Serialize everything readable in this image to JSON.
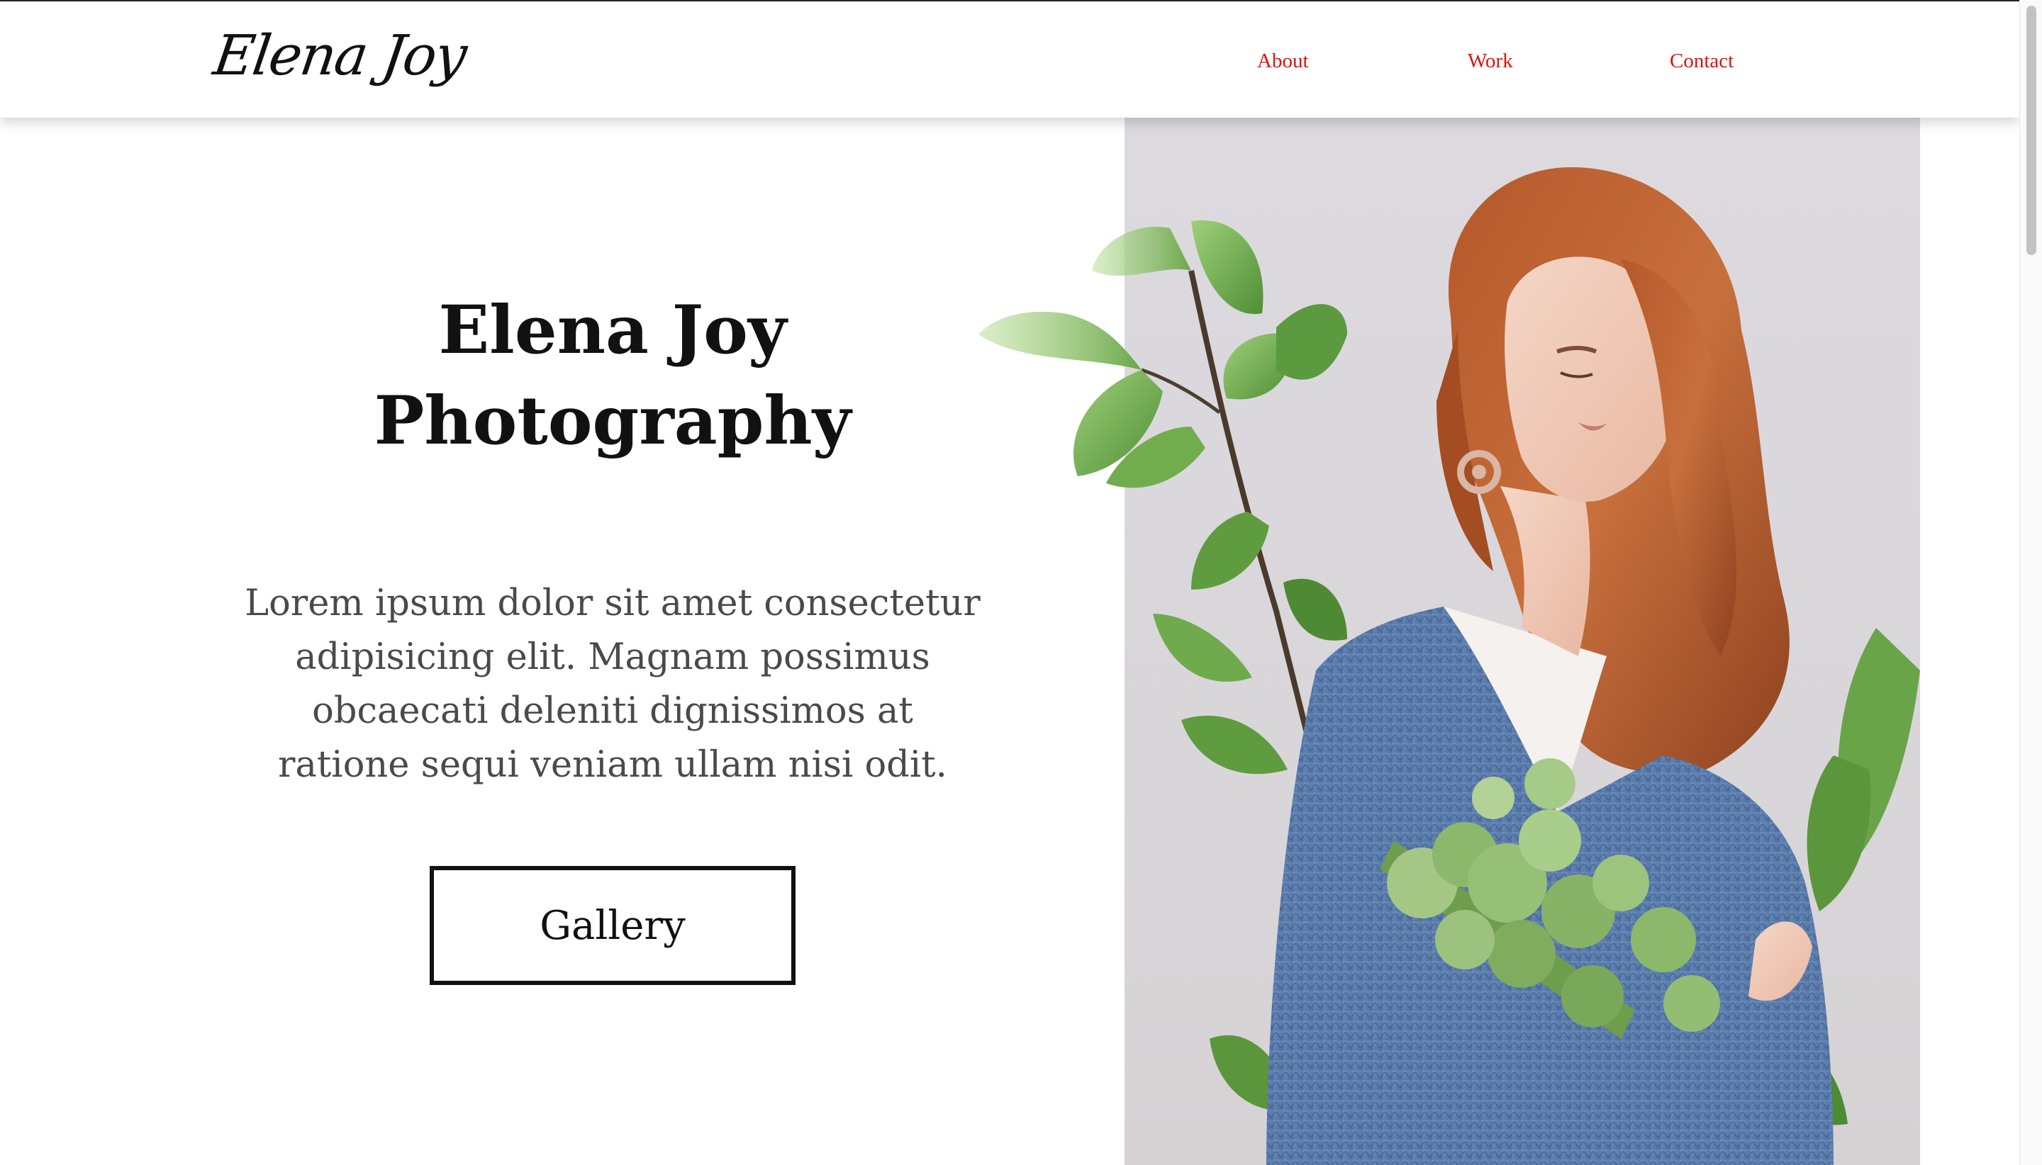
{
  "header": {
    "logo_text": "Elena Joy",
    "nav": [
      {
        "label": "About"
      },
      {
        "label": "Work"
      },
      {
        "label": "Contact"
      }
    ]
  },
  "hero": {
    "title_line1": "Elena Joy",
    "title_line2": "Photography",
    "body": "Lorem ipsum dolor sit amet consectetur adipisicing elit. Magnam possimus obcaecati deleniti dignissimos at ratione sequi veniam ullam nisi odit.",
    "button_label": "Gallery"
  },
  "colors": {
    "nav_link": "#e01010",
    "title": "#111111",
    "body_text": "#4a4a4a",
    "photo_background": "#dcdadf"
  },
  "icons": {
    "hero_image": "woman-with-plants-photo"
  }
}
